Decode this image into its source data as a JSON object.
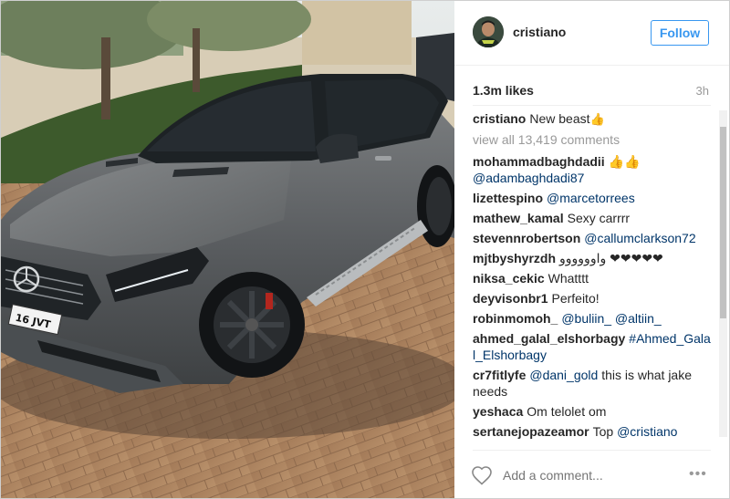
{
  "post": {
    "username": "cristiano",
    "follow_label": "Follow",
    "likes": "1.3m likes",
    "time": "3h",
    "caption_user": "cristiano",
    "caption_text": "New beast",
    "caption_emoji": "👍",
    "view_all": "view all 13,419 comments"
  },
  "comments": [
    {
      "user": "mohammadbaghdadii",
      "text": "👍👍",
      "mention": "@adambaghdadi87"
    },
    {
      "user": "lizettespino",
      "text": "",
      "mention": "@marcetorrees"
    },
    {
      "user": "mathew_kamal",
      "text": "Sexy carrrr",
      "mention": ""
    },
    {
      "user": "stevennrobertson",
      "text": "",
      "mention": "@callumclarkson72"
    },
    {
      "user": "mjtbyshyrzdh",
      "text": "واوووووو ❤❤❤❤❤",
      "mention": ""
    },
    {
      "user": "niksa_cekic",
      "text": "Whatttt",
      "mention": ""
    },
    {
      "user": "deyvisonbr1",
      "text": "Perfeito!",
      "mention": ""
    },
    {
      "user": "robinmomoh_",
      "text": "",
      "mention": "@buliin_ @altiin_"
    },
    {
      "user": "ahmed_galal_elshorbagy",
      "text": "",
      "mention": "#Ahmed_Galal_Elshorbagy"
    },
    {
      "user": "cr7fitlyfe",
      "text": "this is what jake needs",
      "mention": "@dani_gold"
    },
    {
      "user": "yeshaca",
      "text": "Om telolet om",
      "mention": ""
    },
    {
      "user": "sertanejopazeamor",
      "text": "Top",
      "mention": "@cristiano"
    }
  ],
  "footer": {
    "add_comment_placeholder": "Add a comment...",
    "more_label": "•••"
  },
  "photo": {
    "license_plate": "16 JVT"
  },
  "colors": {
    "accent": "#3897f0",
    "mention": "#003569",
    "muted": "#999999"
  },
  "icons": {
    "like": "heart-outline-icon",
    "more": "ellipsis-icon"
  }
}
